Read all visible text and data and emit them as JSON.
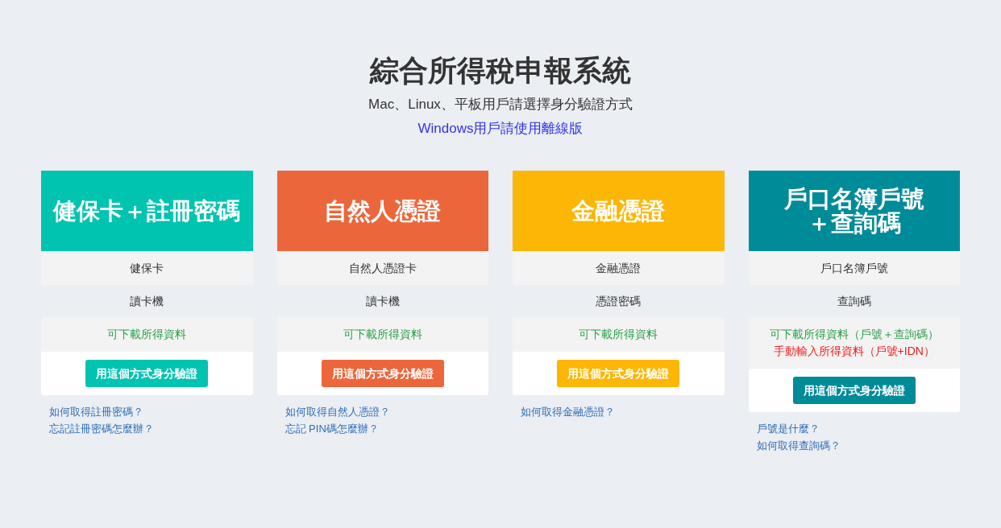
{
  "header": {
    "title": "綜合所得稅申報系統",
    "subtitle": "Mac、Linux、平板用戶請選擇身分驗證方式",
    "offline_link": "Windows用戶請使用離線版"
  },
  "methods": [
    {
      "title_lines": [
        "健保卡＋註冊密碼"
      ],
      "color": "#00c4b0",
      "requirements": [
        "健保卡",
        "讀卡機"
      ],
      "features": [
        {
          "text": "可下載所得資料",
          "color": "#2ba04a"
        }
      ],
      "button": "用這個方式身分驗證",
      "links": [
        "如何取得註冊密碼？",
        "忘記註冊密碼怎麼辦？"
      ]
    },
    {
      "title_lines": [
        "自然人憑證"
      ],
      "color": "#ec663c",
      "requirements": [
        "自然人憑證卡",
        "讀卡機"
      ],
      "features": [
        {
          "text": "可下載所得資料",
          "color": "#2ba04a"
        }
      ],
      "button": "用這個方式身分驗證",
      "links": [
        "如何取得自然人憑證？",
        "忘記 PIN碼怎麼辦？"
      ]
    },
    {
      "title_lines": [
        "金融憑證"
      ],
      "color": "#fcb605",
      "requirements": [
        "金融憑證",
        "憑證密碼"
      ],
      "features": [
        {
          "text": "可下載所得資料",
          "color": "#2ba04a"
        }
      ],
      "button": "用這個方式身分驗證",
      "links": [
        "如何取得金融憑證？"
      ]
    },
    {
      "title_lines": [
        "戶口名簿戶號",
        "＋查詢碼"
      ],
      "color": "#008b99",
      "requirements": [
        "戶口名簿戶號",
        "查詢碼"
      ],
      "features": [
        {
          "text": "可下載所得資料（戶號＋查詢碼）",
          "color": "#2ba04a"
        },
        {
          "text": "手動輸入所得資料（戶號+IDN）",
          "color": "#f41c1c"
        }
      ],
      "button": "用這個方式身分驗證",
      "links": [
        "戶號是什麼？",
        "如何取得查詢碼？"
      ]
    }
  ]
}
